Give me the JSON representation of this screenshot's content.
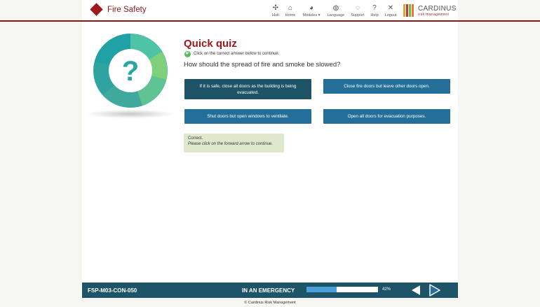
{
  "header": {
    "title": "Fire Safety",
    "brand_accent": "#a0171c",
    "nav": [
      {
        "label": "Hub",
        "icon": "hub-icon",
        "glyph": "✣"
      },
      {
        "label": "Home",
        "icon": "home-icon",
        "glyph": "⌂"
      },
      {
        "label": "Modules ▾",
        "icon": "modules-icon",
        "glyph": "◕"
      },
      {
        "label": "Language",
        "icon": "globe-icon",
        "glyph": "◍"
      },
      {
        "label": "Support",
        "icon": "chat-icon",
        "glyph": "◌"
      },
      {
        "label": "Help",
        "icon": "help-icon",
        "glyph": "?"
      },
      {
        "label": "Logout",
        "icon": "close-icon",
        "glyph": "✕"
      }
    ],
    "brand_name": "CARDINUS",
    "brand_sub": "risk management"
  },
  "quiz": {
    "title": "Quick quiz",
    "instruction": "Click on the correct answer below to continue.",
    "question": "How should the spread of fire and smoke be slowed?",
    "answers": [
      "If it is safe, close all doors as the building is being evacuated.",
      "Close fire doors but leave other doors open.",
      "Shut doors but open windows to ventilate.",
      "Open all doors for evacuation purposes."
    ],
    "feedback_line1": "Correct.",
    "feedback_line2": "Please click on the forward arrow to continue."
  },
  "footer": {
    "code": "FSP-M03-CON-050",
    "section": "IN AN EMERGENCY",
    "progress": 0.42,
    "progress_label": "42%",
    "copyright": "© Cardinus Risk Management"
  }
}
